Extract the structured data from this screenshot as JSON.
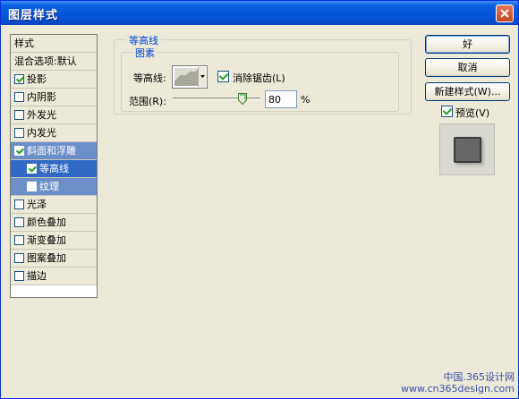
{
  "window": {
    "title": "图层样式"
  },
  "style_list": {
    "items": [
      {
        "label": "样式",
        "checkbox": false,
        "checked": false
      },
      {
        "label": "混合选项:默认",
        "checkbox": false,
        "checked": false
      },
      {
        "label": "投影",
        "checkbox": true,
        "checked": true
      },
      {
        "label": "内阴影",
        "checkbox": true,
        "checked": false
      },
      {
        "label": "外发光",
        "checkbox": true,
        "checked": false
      },
      {
        "label": "内发光",
        "checkbox": true,
        "checked": false
      },
      {
        "label": "斜面和浮雕",
        "checkbox": true,
        "checked": true
      },
      {
        "label": "等高线",
        "checkbox": true,
        "checked": true
      },
      {
        "label": "纹理",
        "checkbox": true,
        "checked": false
      },
      {
        "label": "光泽",
        "checkbox": true,
        "checked": false
      },
      {
        "label": "颜色叠加",
        "checkbox": true,
        "checked": false
      },
      {
        "label": "渐变叠加",
        "checkbox": true,
        "checked": false
      },
      {
        "label": "图案叠加",
        "checkbox": true,
        "checked": false
      },
      {
        "label": "描边",
        "checkbox": true,
        "checked": false
      }
    ]
  },
  "contour_panel": {
    "group_title": "等高线",
    "inner_title": "图素",
    "contour_label": "等高线:",
    "antialias_label": "消除锯齿(L)",
    "antialias_checked": true,
    "range_label": "范围(R):",
    "range_value": "80",
    "range_unit": "%",
    "range_fraction": 0.8
  },
  "buttons": {
    "ok": "好",
    "cancel": "取消",
    "new_style": "新建样式(W)...",
    "preview_label": "预览(V)",
    "preview_checked": true
  },
  "watermark": {
    "line1": "中国.365设计网",
    "line2": "www.cn365design.com"
  }
}
